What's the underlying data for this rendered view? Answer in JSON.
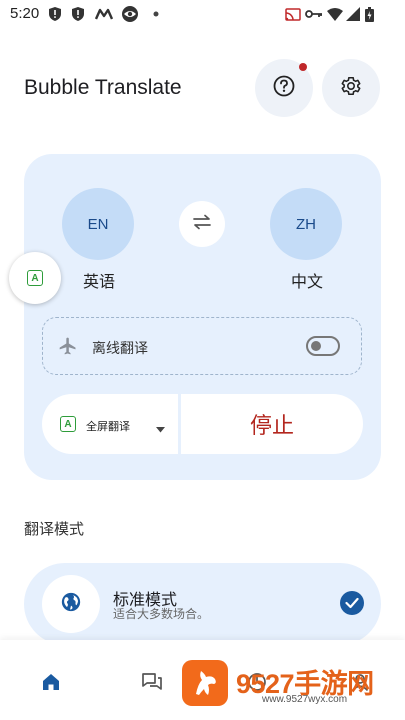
{
  "status_bar": {
    "time": "5:20",
    "left_icons": [
      "shield-alert-icon",
      "shield-alert-icon",
      "m-logo-icon",
      "eye-icon",
      "dot-icon"
    ],
    "right_icons": [
      "cast-icon",
      "key-icon",
      "wifi-icon",
      "signal-icon",
      "battery-icon"
    ]
  },
  "header": {
    "title": "Bubble Translate",
    "help_icon": "help-icon",
    "settings_icon": "gear-icon",
    "notification_color": "#c0282a"
  },
  "languages": {
    "source": {
      "code": "EN",
      "label": "英语"
    },
    "target": {
      "code": "ZH",
      "label": "中文"
    },
    "swap_icon": "swap-arrows-icon"
  },
  "floating_bubble": {
    "icon_letter": "A"
  },
  "offline": {
    "label": "离线翻译",
    "enabled": false,
    "icon": "airplane-icon"
  },
  "controls": {
    "mode_icon_letter": "A",
    "mode_label": "全屏翻译",
    "stop_label": "停止",
    "stop_color": "#b3261e"
  },
  "translation_mode": {
    "section_title": "翻译模式",
    "selected": {
      "title": "标准模式",
      "subtitle": "适合大多数场合。",
      "icon": "globe-icon",
      "checked": true
    }
  },
  "bottom_nav": {
    "items": [
      {
        "icon": "home-icon",
        "active": true
      },
      {
        "icon": "chat-icon",
        "active": false
      },
      {
        "icon": "history-icon",
        "active": false
      },
      {
        "icon": "profile-icon",
        "active": false
      }
    ]
  },
  "watermark": {
    "brand": "9527手游网",
    "url": "www.9527wyx.com"
  },
  "colors": {
    "accent": "#1a5aa0",
    "card_bg": "#e6f0fd",
    "lang_circle": "#c4dcf7",
    "a_icon_green": "#2e9c3a"
  }
}
